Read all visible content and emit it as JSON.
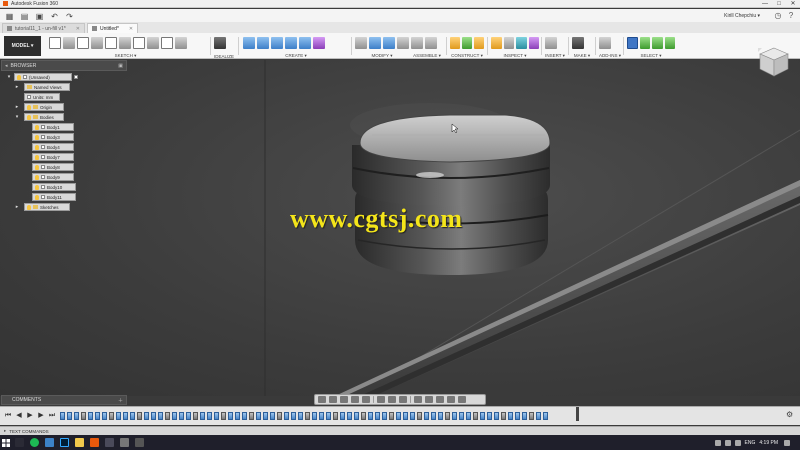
{
  "window": {
    "title": "Autodesk Fusion 360",
    "controls": [
      "—",
      "□",
      "✕"
    ]
  },
  "quick_access": {
    "user": "Kirill Chepchiu ▾"
  },
  "tabs": [
    {
      "label": "tutorial11_1 - un-fill v1*",
      "active": false
    },
    {
      "label": "Untitled*",
      "active": true
    }
  ],
  "toolbar": {
    "workspace": "MODEL ▾",
    "groups": [
      {
        "label": "SKETCH ▾"
      },
      {
        "label": "IDEALIZE"
      },
      {
        "label": "CREATE ▾"
      },
      {
        "label": "MODIFY ▾"
      },
      {
        "label": "ASSEMBLE ▾"
      },
      {
        "label": "CONSTRUCT ▾"
      },
      {
        "label": "INSPECT ▾"
      },
      {
        "label": "INSERT ▾"
      },
      {
        "label": "MAKE ▾"
      },
      {
        "label": "ADD-INS ▾"
      },
      {
        "label": "SELECT ▾"
      }
    ]
  },
  "browser": {
    "title": "BROWSER",
    "root": "(Unsaved)",
    "items": [
      {
        "label": "Named Views",
        "type": "folder"
      },
      {
        "label": "Units: mm",
        "type": "doc"
      },
      {
        "label": "Origin",
        "type": "folder"
      },
      {
        "label": "Bodies",
        "type": "folder"
      },
      {
        "label": "Body1",
        "type": "body"
      },
      {
        "label": "Body3",
        "type": "body"
      },
      {
        "label": "Body4",
        "type": "body"
      },
      {
        "label": "Body7",
        "type": "body"
      },
      {
        "label": "Body8",
        "type": "body"
      },
      {
        "label": "Body9",
        "type": "body"
      },
      {
        "label": "Body10",
        "type": "body"
      },
      {
        "label": "Body11",
        "type": "body"
      },
      {
        "label": "Sketches",
        "type": "folder"
      }
    ]
  },
  "watermark": "www.cgtsj.com",
  "comments": {
    "title": "COMMENTS"
  },
  "text_commands": {
    "label": "TEXT COMMANDS"
  },
  "taskbar": {
    "language": "ENG",
    "time": "4:19 PM",
    "date": ""
  },
  "colors": {
    "viewport_bg": "#3c3c3c",
    "watermark": "#f4e51a",
    "selection_blue": "#3f76c5",
    "taskbar": "#1f1f2b"
  }
}
